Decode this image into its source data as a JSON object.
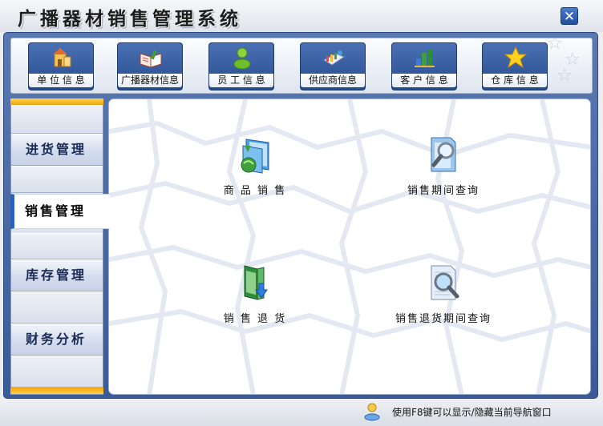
{
  "app": {
    "title": "广播器材销售管理系统",
    "close_label": "✕"
  },
  "toolbar": {
    "items": [
      {
        "label": "单 位 信 息",
        "icon": "building-icon"
      },
      {
        "label": "广播器材信息",
        "icon": "book-icon"
      },
      {
        "label": "员 工 信 息",
        "icon": "person-icon"
      },
      {
        "label": "供应商信息",
        "icon": "supplier-icon"
      },
      {
        "label": "客 户 信 息",
        "icon": "customer-icon"
      },
      {
        "label": "仓 库 信 息",
        "icon": "star-icon"
      }
    ]
  },
  "sidebar": {
    "items": [
      {
        "label": "进货管理",
        "active": false
      },
      {
        "label": "销售管理",
        "active": true
      },
      {
        "label": "库存管理",
        "active": false
      },
      {
        "label": "财务分析",
        "active": false
      }
    ]
  },
  "main": {
    "functions": [
      {
        "label": "商 品 销 售",
        "icon": "sales-icon"
      },
      {
        "label": "销售期间查询",
        "icon": "search-document-icon"
      },
      {
        "label": "销 售 退 货",
        "icon": "return-icon"
      },
      {
        "label": "销售退货期间查询",
        "icon": "search-document-icon"
      }
    ]
  },
  "status": {
    "text": "使用F8键可以显示/隐藏当前导航窗口"
  },
  "colors": {
    "frame_blue": "#3a5b97",
    "tab_accent": "#1f63c8",
    "side_band": "#f2a310"
  }
}
